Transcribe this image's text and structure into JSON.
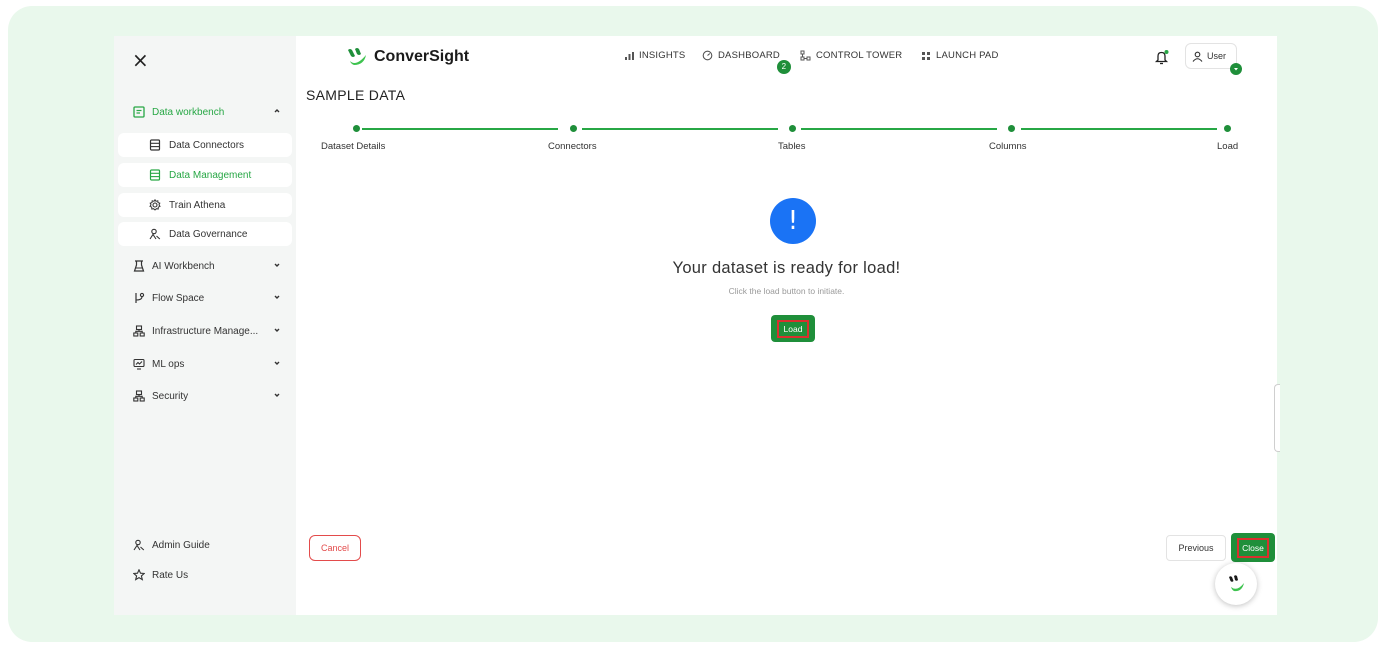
{
  "app": {
    "close_symbol": "×"
  },
  "logo": {
    "text": "ConverSight",
    "icon": "conversight-logo"
  },
  "topnav": {
    "insights": "INSIGHTS",
    "dashboard": "DASHBOARD",
    "dashboard_badge": "2",
    "control_tower": "CONTROL TOWER",
    "launch_pad": "LAUNCH PAD"
  },
  "user": {
    "label": "User"
  },
  "sidebar": {
    "data_workbench": "Data workbench",
    "sub_items": [
      "Data Connectors",
      "Data Management",
      "Train Athena",
      "Data Governance"
    ],
    "ai_workbench": "AI Workbench",
    "flow_space": "Flow Space",
    "infrastructure": "Infrastructure Manage...",
    "ml_ops": "ML ops",
    "security": "Security",
    "admin_guide": "Admin Guide",
    "rate_us": "Rate Us"
  },
  "page": {
    "title": "SAMPLE DATA"
  },
  "stepper": {
    "steps": [
      "Dataset Details",
      "Connectors",
      "Tables",
      "Columns",
      "Load"
    ]
  },
  "ready": {
    "icon_symbol": "!",
    "title": "Your dataset is ready for load!",
    "subtitle": "Click the load button to initiate.",
    "load_label": "Load"
  },
  "footer": {
    "cancel_label": "Cancel",
    "previous_label": "Previous",
    "close_label": "Close"
  },
  "colors": {
    "accent": "#27a745",
    "accent_dark": "#1f8f3a",
    "info": "#1a73f5",
    "danger": "#e34b4b",
    "frame": "#e9f8ec"
  }
}
